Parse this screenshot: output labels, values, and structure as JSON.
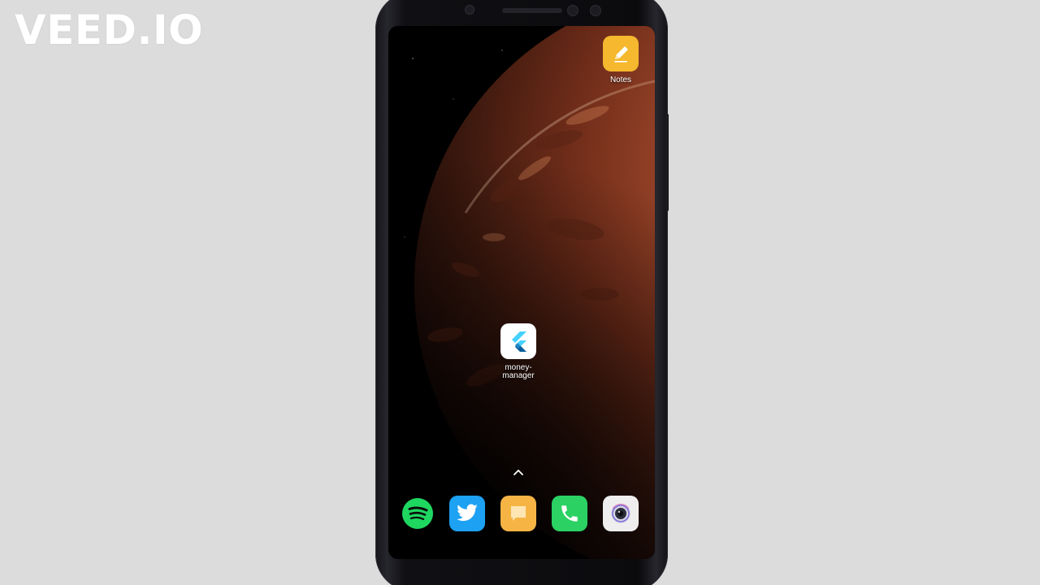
{
  "watermark": {
    "text": "VEED.IO"
  },
  "home_screen": {
    "apps": [
      {
        "id": "notes",
        "label": "Notes",
        "icon": "pencil-icon",
        "icon_color": "#f5b82e"
      },
      {
        "id": "money-manager",
        "label": "money-\nmanager",
        "icon": "flutter-icon",
        "icon_color": "#ffffff"
      }
    ],
    "app_drawer_indicator": "chevron-up-icon",
    "dock": [
      {
        "id": "spotify",
        "icon": "spotify-icon",
        "color": "#1ed760"
      },
      {
        "id": "twitter",
        "icon": "twitter-bird-icon",
        "color": "#1da1f2"
      },
      {
        "id": "messages",
        "icon": "message-bubble-icon",
        "color": "#f6b445"
      },
      {
        "id": "phone",
        "icon": "phone-handset-icon",
        "color": "#2bd163"
      },
      {
        "id": "camera",
        "icon": "camera-lens-icon",
        "color": "#eeeeee"
      }
    ]
  },
  "colors": {
    "background": "#dcdcdc",
    "wallpaper_planet": "#a44a2c"
  }
}
